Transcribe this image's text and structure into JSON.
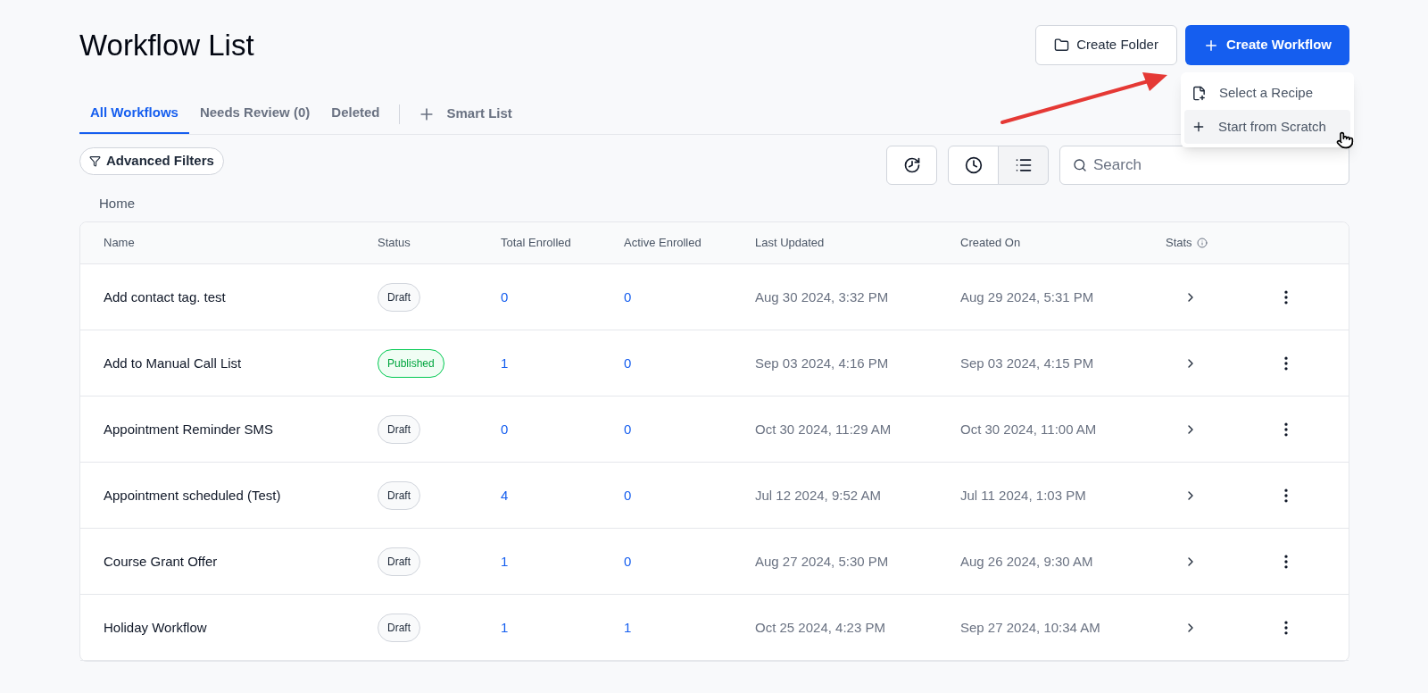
{
  "page_title": "Workflow List",
  "header_buttons": {
    "create_folder": "Create Folder",
    "create_workflow": "Create Workflow"
  },
  "create_menu": [
    {
      "label": "Select a Recipe",
      "kind": "recipe",
      "highlighted": false
    },
    {
      "label": "Start from Scratch",
      "kind": "plus",
      "highlighted": true
    }
  ],
  "tabs": [
    {
      "label": "All Workflows",
      "selected": true
    },
    {
      "label": "Needs Review (0)",
      "selected": false
    },
    {
      "label": "Deleted",
      "selected": false
    }
  ],
  "smart_list": "Smart List",
  "advanced_filters": "Advanced Filters",
  "view_toggle": [
    {
      "kind": "clock",
      "selected": false
    },
    {
      "kind": "list",
      "selected": true
    }
  ],
  "search": {
    "placeholder": "Search"
  },
  "breadcrumb": "Home",
  "table": {
    "columns": [
      "Name",
      "Status",
      "Total Enrolled",
      "Active Enrolled",
      "Last Updated",
      "Created On",
      "Stats"
    ],
    "rows": [
      {
        "name": "Add contact tag. test",
        "status": "Draft",
        "published": false,
        "total": "0",
        "active": "0",
        "updated": "Aug 30 2024, 3:32 PM",
        "created": "Aug 29 2024, 5:31 PM"
      },
      {
        "name": "Add to Manual Call List",
        "status": "Published",
        "published": true,
        "total": "1",
        "active": "0",
        "updated": "Sep 03 2024, 4:16 PM",
        "created": "Sep 03 2024, 4:15 PM"
      },
      {
        "name": "Appointment Reminder SMS",
        "status": "Draft",
        "published": false,
        "total": "0",
        "active": "0",
        "updated": "Oct 30 2024, 11:29 AM",
        "created": "Oct 30 2024, 11:00 AM"
      },
      {
        "name": "Appointment scheduled (Test)",
        "status": "Draft",
        "published": false,
        "total": "4",
        "active": "0",
        "updated": "Jul 12 2024, 9:52 AM",
        "created": "Jul 11 2024, 1:03 PM"
      },
      {
        "name": "Course Grant Offer",
        "status": "Draft",
        "published": false,
        "total": "1",
        "active": "0",
        "updated": "Aug 27 2024, 5:30 PM",
        "created": "Aug 26 2024, 9:30 AM"
      },
      {
        "name": "Holiday Workflow",
        "status": "Draft",
        "published": false,
        "total": "1",
        "active": "1",
        "updated": "Oct 25 2024, 4:23 PM",
        "created": "Sep 27 2024, 10:34 AM"
      }
    ]
  }
}
